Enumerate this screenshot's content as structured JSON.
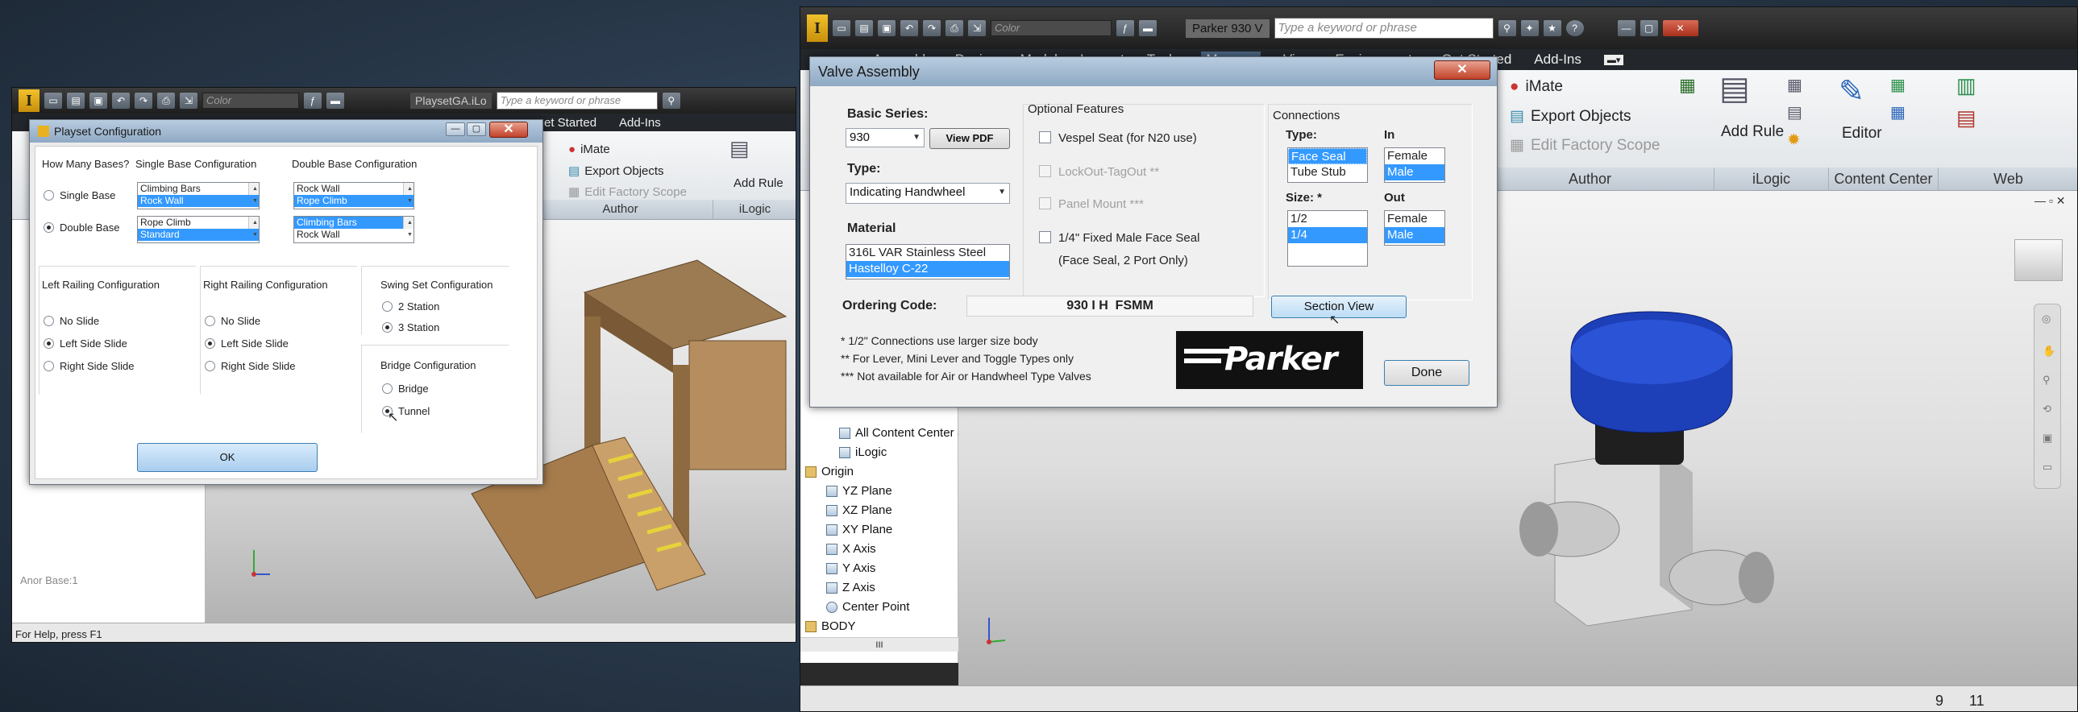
{
  "left_app": {
    "color_combo": "Color",
    "doc_tab": "PlaysetGA.iLo",
    "search_placeholder": "Type a keyword or phrase",
    "tabs": [
      "et Started",
      "Add-Ins"
    ],
    "ribbon": {
      "imate": "iMate",
      "export": "Export Objects",
      "factory": "Edit Factory Scope",
      "add_rule": "Add Rule",
      "group_author": "Author",
      "group_ilogic": "iLogic"
    },
    "browser_fragment": "Anor Base:1",
    "status": "For Help, press F1"
  },
  "playset_dialog": {
    "title": "Playset Configuration",
    "bases_heading": "How Many Bases?",
    "single_base": "Single Base",
    "double_base": "Double Base",
    "single_config_heading": "Single Base Configuration",
    "single_list1": [
      "Climbing Bars",
      "Rock Wall"
    ],
    "single_list2": [
      "Rope Climb",
      "Standard"
    ],
    "double_config_heading": "Double Base Configuration",
    "double_list1": [
      "Rock Wall",
      "Rope Climb"
    ],
    "double_list2": [
      "Climbing Bars",
      "Rock Wall"
    ],
    "left_railing_heading": "Left Railing Configuration",
    "right_railing_heading": "Right Railing Configuration",
    "railing_options": [
      "No Slide",
      "Left Side Slide",
      "Right Side Slide"
    ],
    "swing_heading": "Swing Set Configuration",
    "swing_options": [
      "2 Station",
      "3 Station"
    ],
    "bridge_heading": "Bridge Configuration",
    "bridge_options": [
      "Bridge",
      "Tunnel"
    ],
    "ok": "OK"
  },
  "right_app": {
    "color_combo": "Color",
    "doc_tab": "Parker 930 V",
    "search_placeholder": "Type a keyword or phrase",
    "tabs": [
      "Assembly",
      "Design",
      "Model",
      "Inspect",
      "Tools",
      "Manage",
      "View",
      "Environments",
      "Get Started",
      "Add-Ins"
    ],
    "ribbon": {
      "imate": "iMate",
      "export": "Export Objects",
      "factory": "Edit Factory Scope",
      "add_rule": "Add Rule",
      "editor": "Editor",
      "group_author": "Author",
      "group_ilogic": "iLogic",
      "group_content": "Content Center",
      "group_web": "Web"
    },
    "tree": [
      "All Content Center Supp",
      "iLogic",
      "Origin",
      "YZ Plane",
      "XZ Plane",
      "XY Plane",
      "X Axis",
      "Y Axis",
      "Z Axis",
      "Center Point",
      "BODY"
    ],
    "scroll_glyph": "III",
    "status_nums": [
      "9",
      "11"
    ]
  },
  "valve_dialog": {
    "title": "Valve Assembly",
    "basic_series_label": "Basic Series:",
    "basic_series_value": "930",
    "view_pdf": "View PDF",
    "type_label": "Type:",
    "type_value": "Indicating Handwheel",
    "material_label": "Material",
    "materials": [
      "316L VAR Stainless Steel",
      "Hastelloy C-22"
    ],
    "optional_heading": "Optional Features",
    "opt_vespel": "Vespel Seat (for N20 use)",
    "opt_lockout": "LockOut-TagOut **",
    "opt_panel": "Panel Mount ***",
    "opt_face_seal": "1/4\" Fixed Male Face Seal",
    "opt_face_seal_note": "(Face Seal, 2 Port Only)",
    "connections_heading": "Connections",
    "type_col_label": "Type:",
    "conn_types": [
      "Face Seal",
      "Tube Stub"
    ],
    "in_label": "In",
    "in_options": [
      "Female",
      "Male"
    ],
    "size_label": "Size: *",
    "sizes": [
      "1/2",
      "1/4"
    ],
    "out_label": "Out",
    "out_options": [
      "Female",
      "Male"
    ],
    "ordering_label": "Ordering Code:",
    "ordering_code": "930 I H  FSMM",
    "section_view": "Section View",
    "notes": [
      "* 1/2\" Connections use larger size body",
      "** For Lever, Mini Lever and Toggle Types only",
      "*** Not available for Air or Handwheel Type Valves"
    ],
    "brand": "Parker",
    "done": "Done"
  }
}
